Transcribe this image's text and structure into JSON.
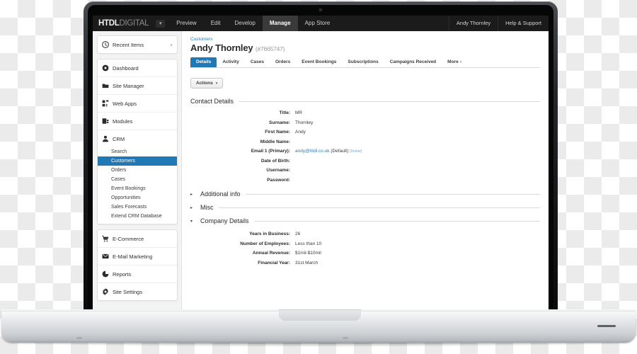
{
  "app": {
    "logo_bold": "HTDL",
    "logo_light": "DIGITAL",
    "logo_caret": "▾",
    "nav": [
      {
        "label": "Preview",
        "active": false
      },
      {
        "label": "Edit",
        "active": false
      },
      {
        "label": "Develop",
        "active": false
      },
      {
        "label": "Manage",
        "active": true
      },
      {
        "label": "App Store",
        "active": false
      }
    ],
    "nav_right": [
      {
        "label": "Andy Thornley"
      },
      {
        "label": "Help & Support"
      }
    ],
    "accent_color": "#2079b5",
    "topbar_color": "#1b1b1b"
  },
  "sidebar": {
    "recent": {
      "label": "Recent Items",
      "icon": "clock-icon",
      "chevron": "▸"
    },
    "items": [
      {
        "label": "Dashboard",
        "icon": "dashboard-icon"
      },
      {
        "label": "Site Manager",
        "icon": "folder-icon"
      },
      {
        "label": "Web Apps",
        "icon": "grid-icon"
      },
      {
        "label": "Modules",
        "icon": "modules-icon"
      },
      {
        "label": "CRM",
        "icon": "person-icon"
      }
    ],
    "crm_sub": [
      {
        "label": "Search",
        "selected": false
      },
      {
        "label": "Customers",
        "selected": true
      },
      {
        "label": "Orders",
        "selected": false
      },
      {
        "label": "Cases",
        "selected": false
      },
      {
        "label": "Event Bookings",
        "selected": false
      },
      {
        "label": "Opportunities",
        "selected": false
      },
      {
        "label": "Sales Forecasts",
        "selected": false
      },
      {
        "label": "Extend CRM Database",
        "selected": false
      }
    ],
    "items_bottom": [
      {
        "label": "E-Commerce",
        "icon": "cart-icon"
      },
      {
        "label": "E-Mail Marketing",
        "icon": "envelope-icon"
      },
      {
        "label": "Reports",
        "icon": "pie-chart-icon"
      },
      {
        "label": "Site Settings",
        "icon": "gear-icon"
      }
    ]
  },
  "main": {
    "breadcrumb": "Customers",
    "title": "Andy Thornley",
    "record_id": "(#7665747)",
    "tabs": [
      {
        "label": "Details",
        "active": true
      },
      {
        "label": "Activity",
        "active": false
      },
      {
        "label": "Cases",
        "active": false
      },
      {
        "label": "Orders",
        "active": false
      },
      {
        "label": "Event Bookings",
        "active": false
      },
      {
        "label": "Subscriptions",
        "active": false
      },
      {
        "label": "Campaigns Received",
        "active": false
      }
    ],
    "more_tab": {
      "label": "More",
      "caret": "▾"
    },
    "actions_button": {
      "label": "Actions",
      "caret": "▾"
    },
    "contact_section": {
      "title": "Contact Details",
      "fields": [
        {
          "label": "Title:",
          "value": "MR"
        },
        {
          "label": "Surname:",
          "value": "Thornley"
        },
        {
          "label": "First Name:",
          "value": "Andy"
        },
        {
          "label": "Middle Name:",
          "value": ""
        },
        {
          "label": "Email 1 (Primary):",
          "value": "",
          "link": "andy@htdl.co.uk",
          "suffix": "(Default)",
          "delete": "[Delete]"
        },
        {
          "label": "Date of Birth:",
          "value": ""
        },
        {
          "label": "Username:",
          "value": ""
        },
        {
          "label": "Password:",
          "value": ""
        }
      ]
    },
    "collapsed_sections": [
      {
        "title": "Additional info",
        "tri": "▸"
      },
      {
        "title": "Misc",
        "tri": "▸"
      }
    ],
    "company_section": {
      "title": "Company Details",
      "tri": "▾",
      "fields": [
        {
          "label": "Years in Business:",
          "value": "26"
        },
        {
          "label": "Number of Employees:",
          "value": "Less than 10"
        },
        {
          "label": "Annual Revenue:",
          "value": "$1mil-$10mil"
        },
        {
          "label": "Financial Year:",
          "value": "31st March"
        }
      ]
    }
  }
}
